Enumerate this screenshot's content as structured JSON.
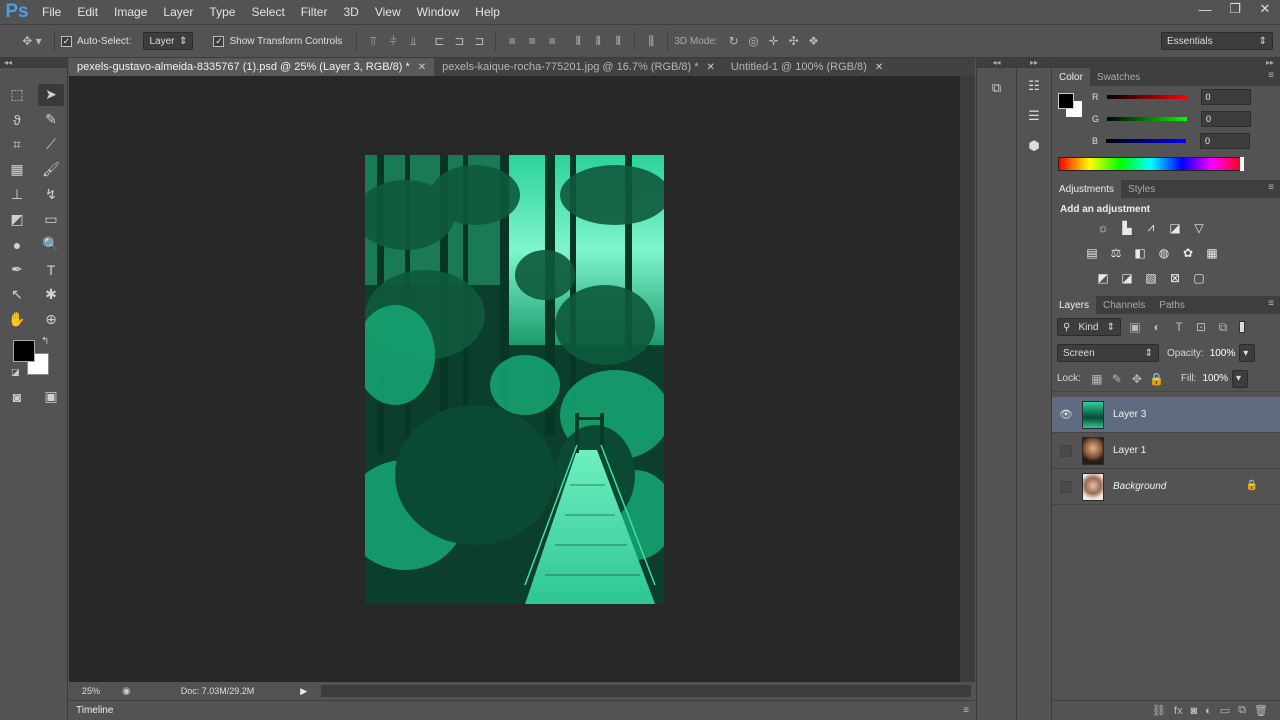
{
  "app": {
    "logo": "Ps"
  },
  "menu": [
    "File",
    "Edit",
    "Image",
    "Layer",
    "Type",
    "Select",
    "Filter",
    "3D",
    "View",
    "Window",
    "Help"
  ],
  "window_controls": {
    "minimize": "—",
    "restore": "❐",
    "close": "✕"
  },
  "options": {
    "auto_select_label": "Auto-Select:",
    "auto_select_value": "Layer",
    "transform_label": "Show Transform Controls",
    "mode_3d_label": "3D Mode:",
    "workspace": "Essentials"
  },
  "tabs": [
    {
      "label": "pexels-gustavo-almeida-8335767 (1).psd @ 25% (Layer 3, RGB/8) *",
      "active": true
    },
    {
      "label": "pexels-kaique-rocha-775201.jpg @ 16.7% (RGB/8) *",
      "active": false
    },
    {
      "label": "Untitled-1 @ 100% (RGB/8)",
      "active": false
    }
  ],
  "status": {
    "zoom": "25%",
    "doc": "Doc: 7.03M/29.2M"
  },
  "timeline_label": "Timeline",
  "color_panel": {
    "tabs": [
      "Color",
      "Swatches"
    ],
    "channels": [
      {
        "name": "R",
        "value": "0",
        "color": "#d42a2a"
      },
      {
        "name": "G",
        "value": "0",
        "color": "#2fbf2f"
      },
      {
        "name": "B",
        "value": "0",
        "color": "#2a3fd4"
      }
    ]
  },
  "adjustments_panel": {
    "tabs": [
      "Adjustments",
      "Styles"
    ],
    "heading": "Add an adjustment"
  },
  "layers_panel": {
    "tabs": [
      "Layers",
      "Channels",
      "Paths"
    ],
    "kind_label": "Kind",
    "blend_mode": "Screen",
    "opacity_label": "Opacity:",
    "opacity_value": "100%",
    "lock_label": "Lock:",
    "fill_label": "Fill:",
    "fill_value": "100%",
    "layers": [
      {
        "name": "Layer 3",
        "visible": true,
        "selected": true,
        "locked": false
      },
      {
        "name": "Layer 1",
        "visible": false,
        "selected": false,
        "locked": false
      },
      {
        "name": "Background",
        "visible": false,
        "selected": false,
        "locked": true
      }
    ]
  },
  "colors": {
    "accent_blue": "#4aa0e6",
    "layer_selected": "#5f6b80",
    "canvas_tint": "#1fa37a"
  }
}
